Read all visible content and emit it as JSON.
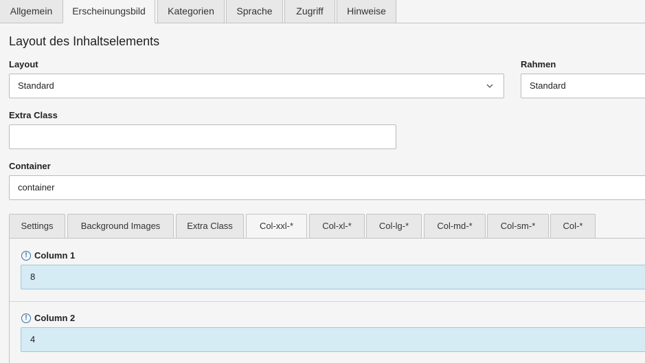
{
  "top_tabs": [
    {
      "label": "Allgemein",
      "active": false
    },
    {
      "label": "Erscheinungsbild",
      "active": true
    },
    {
      "label": "Kategorien",
      "active": false
    },
    {
      "label": "Sprache",
      "active": false
    },
    {
      "label": "Zugriff",
      "active": false
    },
    {
      "label": "Hinweise",
      "active": false
    }
  ],
  "section_title": "Layout des Inhaltselements",
  "layout": {
    "label": "Layout",
    "value": "Standard"
  },
  "rahmen": {
    "label": "Rahmen",
    "value": "Standard"
  },
  "extra_class": {
    "label": "Extra Class",
    "value": ""
  },
  "container": {
    "label": "Container",
    "value": "container"
  },
  "inner_tabs": [
    {
      "label": "Settings",
      "active": false
    },
    {
      "label": "Background Images",
      "active": false
    },
    {
      "label": "Extra Class",
      "active": false
    },
    {
      "label": "Col-xxl-*",
      "active": true
    },
    {
      "label": "Col-xl-*",
      "active": false
    },
    {
      "label": "Col-lg-*",
      "active": false
    },
    {
      "label": "Col-md-*",
      "active": false
    },
    {
      "label": "Col-sm-*",
      "active": false
    },
    {
      "label": "Col-*",
      "active": false
    }
  ],
  "columns": [
    {
      "label": "Column 1",
      "value": "8"
    },
    {
      "label": "Column 2",
      "value": "4"
    }
  ],
  "info_glyph": "!",
  "colors": {
    "accent": "#2f6fa8",
    "highlight_field": "#d5ecf4"
  }
}
